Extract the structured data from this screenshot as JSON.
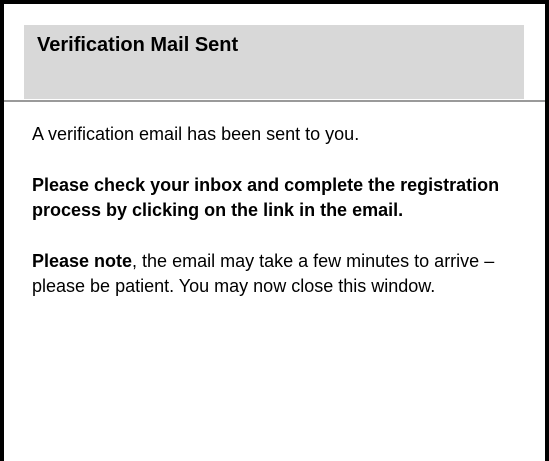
{
  "dialog": {
    "title": "Verification Mail Sent",
    "message": "A verification email has been sent to you.",
    "instruction": "Please check your inbox and complete the registration process by clicking on the link in the email.",
    "note_label": "Please note",
    "note_text": ", the email may take a few minutes to arrive – please be patient.  You may now close this window."
  }
}
